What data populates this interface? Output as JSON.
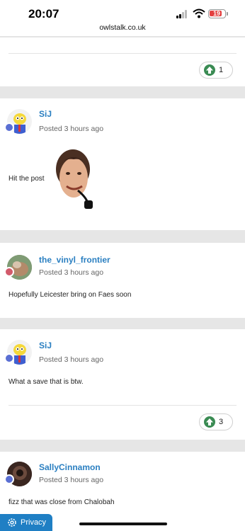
{
  "status_bar": {
    "time": "20:07",
    "url": "owlstalk.co.uk",
    "battery": "19"
  },
  "top_post": {
    "likes": "1"
  },
  "posts": [
    {
      "username": "SiJ",
      "posted": "Posted 3 hours ago",
      "text": "Hit the post"
    },
    {
      "username": "the_vinyl_frontier",
      "posted": "Posted 3 hours ago",
      "text": "Hopefully Leicester bring on Faes soon"
    },
    {
      "username": "SiJ",
      "posted": "Posted 3 hours ago",
      "text": "What a save that is btw.",
      "likes": "3"
    },
    {
      "username": "SallyCinnamon",
      "posted": "Posted 3 hours ago",
      "text": "fizz that was close from Chalobah"
    }
  ],
  "footer": {
    "privacy_label": "Privacy"
  },
  "colors": {
    "link": "#2a7fc1",
    "upvote": "#3a8b53",
    "privacy": "#1f7fc4"
  }
}
